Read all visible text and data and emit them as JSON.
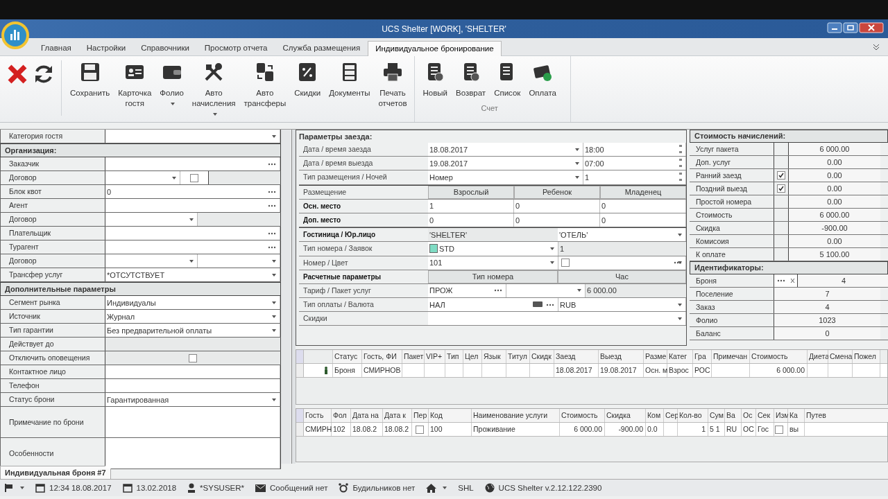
{
  "window": {
    "title": "UCS Shelter [WORK], 'SHELTER'"
  },
  "ribbon_tabs": [
    {
      "label": "Главная",
      "selected": false
    },
    {
      "label": "Настройки",
      "selected": false
    },
    {
      "label": "Справочники",
      "selected": false
    },
    {
      "label": "Просмотр отчета",
      "selected": false
    },
    {
      "label": "Служба размещения",
      "selected": false
    },
    {
      "label": "Индивидуальное бронирование",
      "selected": true
    }
  ],
  "toolbar": {
    "buttons": [
      {
        "label": "Сохранить",
        "dropdown": false
      },
      {
        "label": "Карточка гостя",
        "dropdown": false
      },
      {
        "label": "Фолио",
        "dropdown": true
      },
      {
        "label": "Авто начисления",
        "dropdown": true
      },
      {
        "label": "Авто трансферы",
        "dropdown": false
      },
      {
        "label": "Скидки",
        "dropdown": false
      },
      {
        "label": "Документы",
        "dropdown": false
      },
      {
        "label": "Печать отчетов",
        "dropdown": false
      }
    ],
    "group": {
      "label": "Счет",
      "buttons": [
        {
          "label": "Новый"
        },
        {
          "label": "Возврат"
        },
        {
          "label": "Список"
        },
        {
          "label": "Оплата"
        }
      ]
    }
  },
  "guest_form": {
    "rows": [
      {
        "kind": "dropdown",
        "label": "Категория гостя"
      },
      {
        "kind": "section",
        "label": "Организация:"
      },
      {
        "kind": "lookup",
        "label": "Заказчик"
      },
      {
        "kind": "contract_check",
        "label": "Договор",
        "checked": false
      },
      {
        "kind": "lookup",
        "label": "Блок квот",
        "value": "0"
      },
      {
        "kind": "lookup",
        "label": "Агент"
      },
      {
        "kind": "contract",
        "label": "Договор"
      },
      {
        "kind": "lookup",
        "label": "Плательщик"
      },
      {
        "kind": "lookup",
        "label": "Турагент"
      },
      {
        "kind": "dual_dropdown",
        "label": "Договор"
      },
      {
        "kind": "dropdown",
        "label": "Трансфер услуг",
        "value": "*ОТСУТСТВУЕТ"
      },
      {
        "kind": "section",
        "label": "Дополнительные параметры"
      },
      {
        "kind": "dropdown",
        "label": "Сегмент рынка",
        "value": "Индивидуалы"
      },
      {
        "kind": "dropdown",
        "label": "Источник",
        "value": "Журнал"
      },
      {
        "kind": "dropdown",
        "label": "Тип гарантии",
        "value": "Без предварительной оплаты"
      },
      {
        "kind": "plain",
        "label": "Действует до"
      },
      {
        "kind": "check",
        "label": "Отключить оповещения",
        "checked": false
      },
      {
        "kind": "text",
        "label": "Контактное лицо"
      },
      {
        "kind": "text",
        "label": "Телефон"
      },
      {
        "kind": "dropdown",
        "label": "Статус брони",
        "value": "Гарантированная"
      },
      {
        "kind": "memo",
        "label": "Примечание по брони"
      },
      {
        "kind": "memo",
        "label": "Особенности"
      }
    ]
  },
  "stay": {
    "title": "Параметры заезда:",
    "dates": [
      {
        "label": "Дата / время заезда",
        "date": "18.08.2017",
        "time": "18:00"
      },
      {
        "label": "Дата / время выезда",
        "date": "19.08.2017",
        "time": "07:00"
      }
    ],
    "placement_type": {
      "label": "Тип размещения / Ночей",
      "value": "Номер",
      "nights": "1"
    },
    "occupancy": {
      "label": "Размещение",
      "columns": [
        "Взрослый",
        "Ребенок",
        "Младенец"
      ],
      "rows": [
        {
          "label": "Осн. место",
          "values": [
            "1",
            "0",
            "0"
          ]
        },
        {
          "label": "Доп. место",
          "values": [
            "0",
            "0",
            "0"
          ]
        }
      ]
    },
    "hotel": {
      "label": "Гостиница / Юр.лицо",
      "value": "'SHELTER'",
      "entity": "'ОТЕЛЬ'"
    },
    "room_type": {
      "label": "Тип номера / Заявок",
      "value": "STD",
      "requests": "1"
    },
    "room": {
      "label": "Номер / Цвет",
      "value": "101"
    },
    "billing": {
      "label": "Расчетные параметры",
      "columns": [
        "Тип номера",
        "Час"
      ]
    },
    "tariff": {
      "label": "Тариф / Пакет услуг",
      "value": "ПРОЖ",
      "price": "6 000.00"
    },
    "payment": {
      "label": "Тип оплаты / Валюта",
      "value": "НАЛ",
      "currency": "RUB"
    },
    "discounts": {
      "label": "Скидки"
    }
  },
  "charges": {
    "title": "Стоимость начислений:",
    "rows": [
      {
        "label": "Услуг пакета",
        "checked": false,
        "value": "6 000.00"
      },
      {
        "label": "Доп. услуг",
        "checked": false,
        "value": "0.00"
      },
      {
        "label": "Ранний заезд",
        "checked": true,
        "value": "0.00"
      },
      {
        "label": "Поздний выезд",
        "checked": true,
        "value": "0.00"
      },
      {
        "label": "Простой номера",
        "checked": false,
        "value": "0.00"
      },
      {
        "label": "Стоимость",
        "checked": false,
        "value": "6 000.00"
      },
      {
        "label": "Скидка",
        "checked": false,
        "value": "-900.00"
      },
      {
        "label": "Комисоия",
        "checked": false,
        "value": "0.00"
      },
      {
        "label": "К оплате",
        "checked": false,
        "value": "5 100.00"
      }
    ]
  },
  "identifiers": {
    "title": "Идентификаторы:",
    "rows": [
      {
        "kind": "lookup",
        "label": "Броня",
        "value": "4"
      },
      {
        "kind": "plain",
        "label": "Поселение",
        "value": "7"
      },
      {
        "kind": "plain",
        "label": "Заказ",
        "value": "4"
      },
      {
        "kind": "plain",
        "label": "Фолио",
        "value": "1023"
      },
      {
        "kind": "plain",
        "label": "Баланс",
        "value": "0"
      }
    ]
  },
  "guests_grid": {
    "columns": [
      "Статус",
      "Гость, ФИ",
      "Пакет",
      "VIP+",
      "Тип",
      "Цел",
      "Язык",
      "Титул",
      "Скидк",
      "Заезд",
      "Выезд",
      "Разме",
      "Катег",
      "Гра",
      "Примечан",
      "Стоимость",
      "Диета",
      "Смена",
      "Пожел"
    ],
    "rows": [
      {
        "cells": [
          "Броня",
          "СМИРНОВ",
          null,
          null,
          null,
          null,
          null,
          null,
          null,
          "18.08.2017",
          "19.08.2017",
          "Осн. м",
          "Взрос",
          "РОС",
          null,
          "6 000.00",
          null,
          null,
          null
        ]
      }
    ]
  },
  "services_grid": {
    "columns": [
      "Гость",
      "Фол",
      "Дата на",
      "Дата к",
      "Пер",
      "Код",
      "Наименование услуги",
      "Стоимость",
      "Скидка",
      "Ком",
      "Сер",
      "Кол-во",
      "Сум",
      "Ва",
      "Ос",
      "Сек",
      "Изм",
      "Ка",
      "Путев"
    ],
    "rows": [
      {
        "cells": [
          "СМИРН",
          "102",
          "18.08.2",
          "18.08.2",
          {
            "checked": false
          },
          "100",
          "Проживание",
          "6 000.00",
          "-900.00",
          "0.0",
          null,
          "1",
          "5 1",
          "RU",
          "ОС",
          "Гос",
          {
            "checked": false
          },
          "вы",
          null
        ]
      }
    ]
  },
  "document_tab": {
    "label": "Индивидуальная броня #7"
  },
  "status_bar": [
    {
      "text": "12:34 18.08.2017"
    },
    {
      "text": "13.02.2018"
    },
    {
      "text": "*SYSUSER*"
    },
    {
      "text": "Сообщений нет"
    },
    {
      "text": "Будильников нет"
    },
    {
      "text": "SHL"
    },
    {
      "text": "UCS Shelter v.2.12.122.2390"
    }
  ]
}
